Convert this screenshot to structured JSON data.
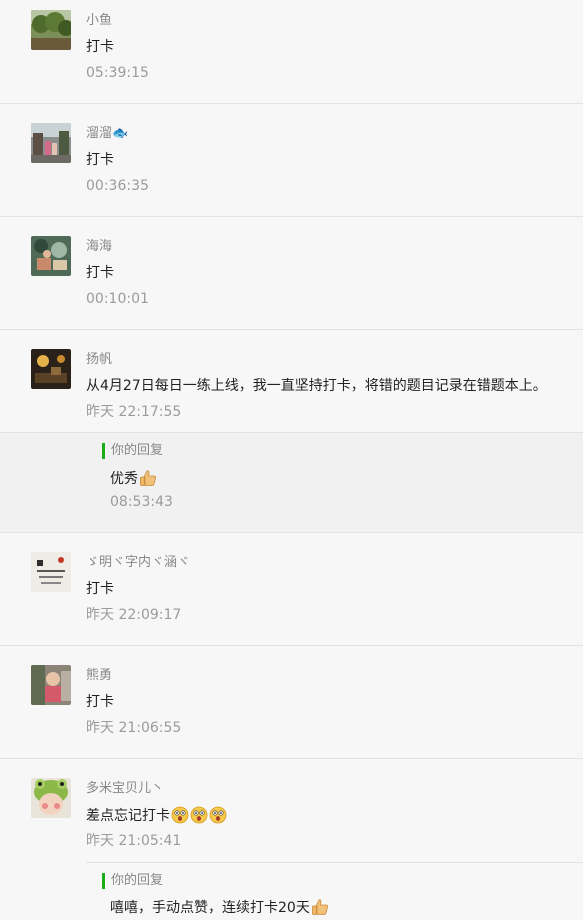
{
  "comments": [
    {
      "name": "小鱼",
      "text": "打卡",
      "time": "05:39:15",
      "avatar": "landscape-avatar"
    },
    {
      "name": "溜溜🐟",
      "text": "打卡",
      "time": "00:36:35",
      "avatar": "street-avatar"
    },
    {
      "name": "海海",
      "text": "打卡",
      "time": "00:10:01",
      "avatar": "market-avatar"
    },
    {
      "name": "扬帆",
      "text": "从4月27日每日一练上线，我一直坚持打卡，将错的题目记录在错题本上。",
      "time": "昨天 22:17:55",
      "avatar": "room-avatar",
      "reply": {
        "label": "你的回复",
        "text": "优秀",
        "emoji": "thumbs-up-icon",
        "time": "08:53:43"
      }
    },
    {
      "name": "ゞ明ヾ字内ヾ涵ヾ",
      "text": "打卡",
      "time": "昨天 22:09:17",
      "avatar": "calligraphy-avatar"
    },
    {
      "name": "熊勇",
      "text": "打卡",
      "time": "昨天 21:06:55",
      "avatar": "child-avatar"
    },
    {
      "name": "多米宝贝儿丶",
      "text": "差点忘记打卡",
      "emojis": [
        "shocked-face-icon",
        "shocked-face-icon",
        "shocked-face-icon"
      ],
      "time": "昨天 21:05:41",
      "avatar": "frog-hat-baby-avatar",
      "reply": {
        "label": "你的回复",
        "text": "嘻嘻，手动点赞，连续打卡20天",
        "emoji": "thumbs-up-icon"
      }
    }
  ],
  "colors": {
    "background": "#f7f7f7",
    "reply_background": "#f1f1f1",
    "reply_accent": "#1aad19",
    "name": "#888888",
    "text": "#222222",
    "time": "#9b9b9b"
  }
}
